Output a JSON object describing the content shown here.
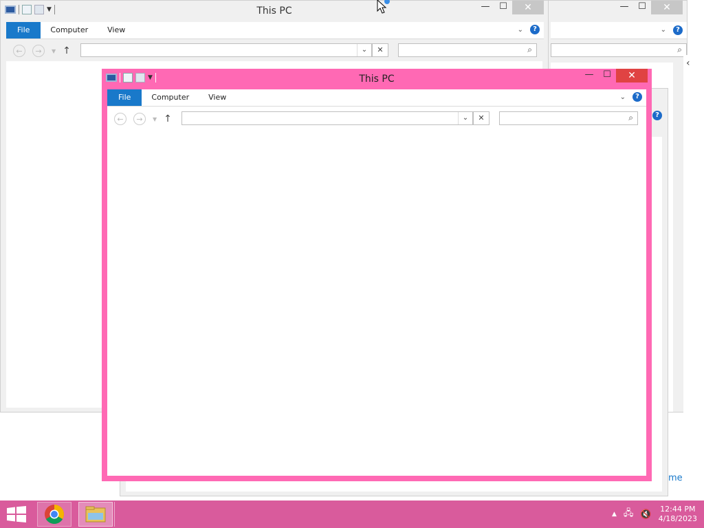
{
  "windows": {
    "back": {
      "title": "This PC",
      "tabs": [
        {
          "label": "File"
        },
        {
          "label": "Computer"
        },
        {
          "label": "View"
        }
      ],
      "close": "✕",
      "minimize": "—",
      "maximize": "☐"
    },
    "front": {
      "title": "This PC",
      "tabs": [
        {
          "label": "File"
        },
        {
          "label": "Computer"
        },
        {
          "label": "View"
        }
      ],
      "close": "✕",
      "minimize": "—",
      "maximize": "☐",
      "border_color": "#ff69b4"
    }
  },
  "partial_text": "me",
  "clock": {
    "time": "12:44 PM",
    "date": "4/18/2023"
  },
  "colors": {
    "taskbar": "#d95b9c",
    "accent": "#1979ca",
    "front_frame": "#ff69b4"
  }
}
